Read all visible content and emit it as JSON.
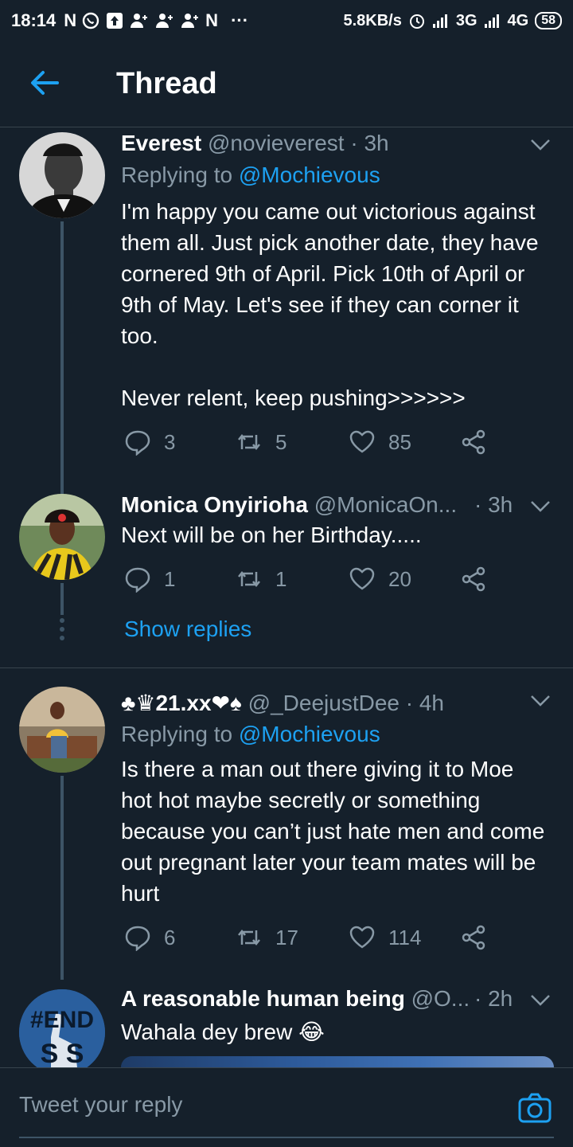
{
  "status_bar": {
    "time": "18:14",
    "left_icons": [
      "N",
      "whatsapp-icon",
      "upload-icon",
      "person-add-icon",
      "person-add-icon",
      "person-add-icon",
      "N",
      "···"
    ],
    "network_speed": "5.8KB/s",
    "net1": "3G",
    "net2": "4G",
    "battery": "58"
  },
  "header": {
    "title": "Thread"
  },
  "tweets": [
    {
      "name": "Everest",
      "handle": "@novieverest · 3h",
      "replying_label": "Replying to",
      "replying_to": "@Mochievous",
      "text": "I'm happy you came out victorious against them all. Just pick another date, they have cornered 9th of April. Pick 10th of April or 9th of May. Let's see if they can corner it too.\n\nNever relent, keep pushing>>>>>>",
      "replies": "3",
      "retweets": "5",
      "likes": "85"
    },
    {
      "name": "Monica Onyirioha",
      "handle": "@MonicaOn...",
      "time": "· 3h",
      "text": "Next will be on her Birthday.....",
      "replies": "1",
      "retweets": "1",
      "likes": "20",
      "show_replies": "Show replies"
    },
    {
      "name": "♣♛21.xx❤♠",
      "handle": "@_DeejustDee · 4h",
      "replying_label": "Replying to",
      "replying_to": "@Mochievous",
      "text": "Is there a man out there giving it to Moe hot hot maybe secretly or something because you can’t just hate men and come out pregnant later your team mates will be hurt",
      "replies": "6",
      "retweets": "17",
      "likes": "114"
    },
    {
      "name": "A reasonable human being",
      "handle": "@O...",
      "time": "· 2h",
      "text": "Wahala dey brew 😂",
      "avatar_text": "#END SARS"
    }
  ],
  "reply_bar": {
    "placeholder": "Tweet your reply"
  },
  "colors": {
    "background": "#15202b",
    "accent": "#1da1f2",
    "muted": "#8899a6",
    "divider": "#38444d"
  }
}
